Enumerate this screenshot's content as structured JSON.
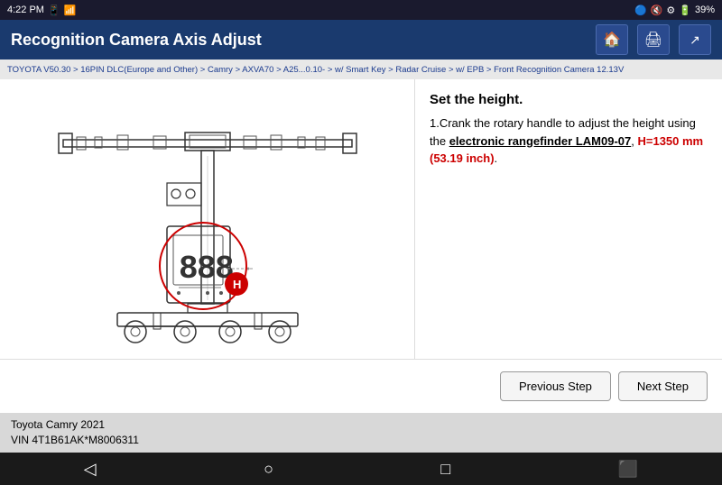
{
  "statusBar": {
    "time": "4:22 PM",
    "battery": "39%",
    "icons": [
      "bluetooth",
      "volume",
      "settings",
      "battery"
    ]
  },
  "titleBar": {
    "title": "Recognition Camera Axis Adjust",
    "homeIcon": "🏠",
    "printIcon": "🖨",
    "exportIcon": "📤"
  },
  "breadcrumb": {
    "text": "TOYOTA V50.30 > 16PIN DLC(Europe and Other) > Camry > AXVA70 > A25...0.10- > w/ Smart Key > Radar Cruise > w/ EPB > Front Recognition Camera  12.13V"
  },
  "instruction": {
    "title": "Set the height.",
    "body_start": "1.Crank the rotary handle to adjust the height using the ",
    "highlight": "electronic rangefinder LAM09-07",
    "body_mid": ", ",
    "red": "H=1350 mm (53.19 inch)",
    "body_end": "."
  },
  "buttons": {
    "previous": "Previous Step",
    "next": "Next Step"
  },
  "vehicleInfo": {
    "line1": "Toyota Camry 2021",
    "line2": "VIN 4T1B61AK*M8006311"
  },
  "androidNav": {
    "back": "◁",
    "home": "○",
    "recent": "□",
    "screenshot": "⬛"
  }
}
